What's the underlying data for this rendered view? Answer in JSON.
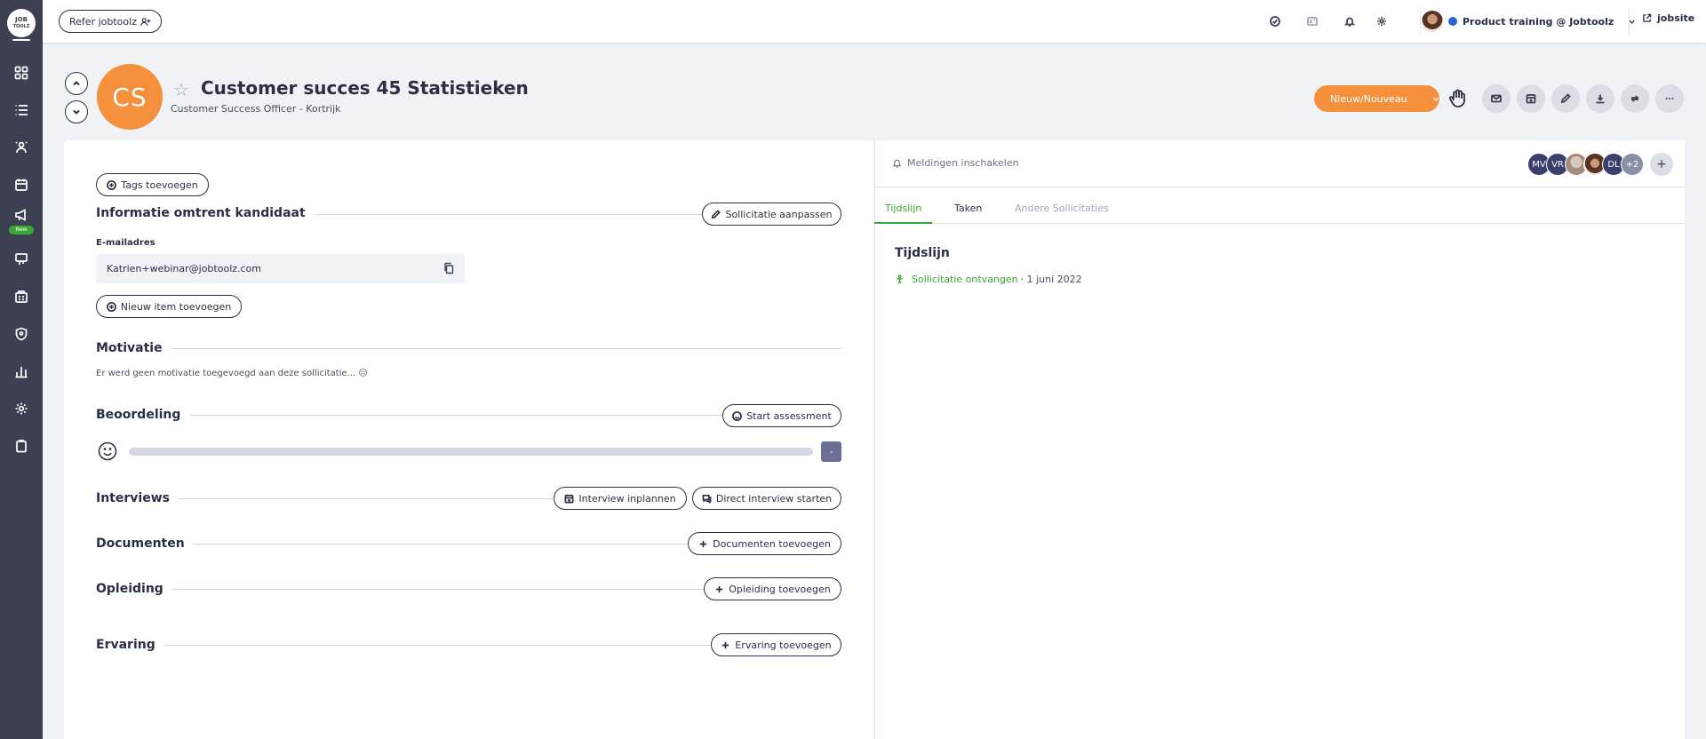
{
  "brand": {
    "logo_top": "JOB",
    "logo_bottom": "TOOLZ",
    "new_badge": "New"
  },
  "topbar": {
    "refer_label": "Refer jobtoolz",
    "workspace": "Product training @ Jobtoolz",
    "jobsite_label": "jobsite"
  },
  "candidate": {
    "initials": "CS",
    "name": "Customer succes 45 Statistieken",
    "subtitle": "Customer Success Officer - Kortrijk"
  },
  "actions": {
    "new_label": "Nieuw/Nouveau"
  },
  "left": {
    "tags_button": "Tags toevoegen",
    "info_title": "Informatie omtrent kandidaat",
    "edit_application_button": "Sollicitatie aanpassen",
    "email_label": "E-mailadres",
    "email_value": "Katrien+webinar@jobtoolz.com",
    "add_item_button": "Nieuw item toevoegen",
    "motivation_title": "Motivatie",
    "motivation_text": "Er werd geen motivatie toegevoegd aan deze sollicitatie... 😑",
    "rating_title": "Beoordeling",
    "start_assessment_button": "Start assessment",
    "score_value": "-",
    "interviews_title": "Interviews",
    "plan_interview_button": "Interview inplannen",
    "direct_interview_button": "Direct interview starten",
    "documents_title": "Documenten",
    "add_documents_button": "Documenten toevoegen",
    "education_title": "Opleiding",
    "add_education_button": "Opleiding toevoegen",
    "experience_title": "Ervaring",
    "add_experience_button": "Ervaring toevoegen"
  },
  "right": {
    "notifications_label": "Meldingen inschakelen",
    "team": [
      {
        "initials": "MV",
        "color": "#3a3f6b"
      },
      {
        "initials": "VR",
        "color": "#3a3f6b"
      },
      {
        "initials": "",
        "color": "#b9a89a"
      },
      {
        "initials": "",
        "color": "#5a3222"
      },
      {
        "initials": "DL",
        "color": "#3a3f6b"
      },
      {
        "initials": "+2",
        "color": "#8a8fa8"
      }
    ],
    "tabs": [
      "Tijdslijn",
      "Taken",
      "Andere Sollicitaties"
    ],
    "timeline_title": "Tijdslijn",
    "timeline_event": "Sollicitatie ontvangen",
    "timeline_date": "· 1 juni 2022"
  },
  "colors": {
    "accent": "#f5913d",
    "success": "#3aa635",
    "sidebar": "#3d3f52"
  }
}
